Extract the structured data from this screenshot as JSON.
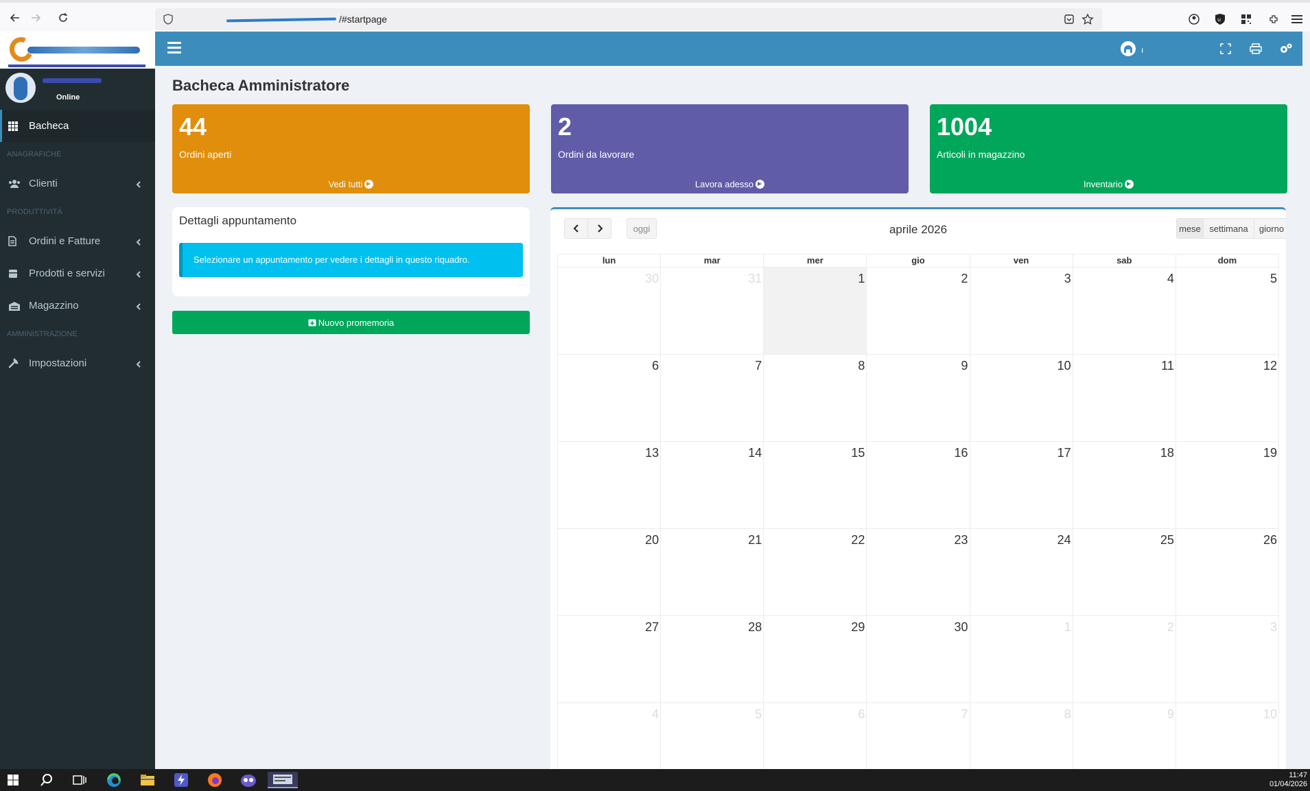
{
  "browser": {
    "url_path": "/#startpage"
  },
  "sidebar": {
    "user_status": "Online",
    "items": [
      {
        "type": "item",
        "label": "Bacheca",
        "icon": "grid-icon",
        "active": true
      },
      {
        "type": "header",
        "label": "ANAGRAFICHE"
      },
      {
        "type": "item",
        "label": "Clienti",
        "icon": "users-icon"
      },
      {
        "type": "header",
        "label": "PRODUTTIVITÀ"
      },
      {
        "type": "item",
        "label": "Ordini e Fatture",
        "icon": "document-icon"
      },
      {
        "type": "item",
        "label": "Prodotti e servizi",
        "icon": "box-icon"
      },
      {
        "type": "item",
        "label": "Magazzino",
        "icon": "warehouse-icon"
      },
      {
        "type": "header",
        "label": "AMMINISTRAZIONE"
      },
      {
        "type": "item",
        "label": "Impostazioni",
        "icon": "wrench-icon"
      }
    ]
  },
  "main": {
    "title": "Bacheca Amministratore",
    "stats": [
      {
        "value": "44",
        "label": "Ordini aperti",
        "link": "Vedi tutti",
        "color": "#e08e0b"
      },
      {
        "value": "2",
        "label": "Ordini da lavorare",
        "link": "Lavora adesso",
        "color": "#605ca8"
      },
      {
        "value": "1004",
        "label": "Articoli in magazzino",
        "link": "Inventario",
        "color": "#00a65a"
      }
    ],
    "details": {
      "title": "Dettagli appuntamento",
      "message": "Selezionare un appuntamento per vedere i dettagli in questo riquadro."
    },
    "reminder_button": "Nuovo promemoria"
  },
  "calendar": {
    "title": "aprile 2026",
    "today_button": "oggi",
    "views": [
      "mese",
      "settimana",
      "giorno"
    ],
    "weekdays": [
      "lun",
      "mar",
      "mer",
      "gio",
      "ven",
      "sab",
      "dom"
    ],
    "weeks": [
      [
        {
          "d": "30",
          "o": true
        },
        {
          "d": "31",
          "o": true
        },
        {
          "d": "1",
          "t": true
        },
        {
          "d": "2"
        },
        {
          "d": "3"
        },
        {
          "d": "4"
        },
        {
          "d": "5"
        }
      ],
      [
        {
          "d": "6"
        },
        {
          "d": "7"
        },
        {
          "d": "8"
        },
        {
          "d": "9"
        },
        {
          "d": "10"
        },
        {
          "d": "11"
        },
        {
          "d": "12"
        }
      ],
      [
        {
          "d": "13"
        },
        {
          "d": "14"
        },
        {
          "d": "15"
        },
        {
          "d": "16"
        },
        {
          "d": "17"
        },
        {
          "d": "18"
        },
        {
          "d": "19"
        }
      ],
      [
        {
          "d": "20"
        },
        {
          "d": "21"
        },
        {
          "d": "22"
        },
        {
          "d": "23"
        },
        {
          "d": "24"
        },
        {
          "d": "25"
        },
        {
          "d": "26"
        }
      ],
      [
        {
          "d": "27"
        },
        {
          "d": "28"
        },
        {
          "d": "29"
        },
        {
          "d": "30"
        },
        {
          "d": "1",
          "o": true
        },
        {
          "d": "2",
          "o": true
        },
        {
          "d": "3",
          "o": true
        }
      ],
      [
        {
          "d": "4",
          "o": true
        },
        {
          "d": "5",
          "o": true
        },
        {
          "d": "6",
          "o": true
        },
        {
          "d": "7",
          "o": true
        },
        {
          "d": "8",
          "o": true
        },
        {
          "d": "9",
          "o": true
        },
        {
          "d": "10",
          "o": true
        }
      ]
    ]
  },
  "taskbar": {
    "time": "11:47",
    "date": "01/04/2026"
  }
}
